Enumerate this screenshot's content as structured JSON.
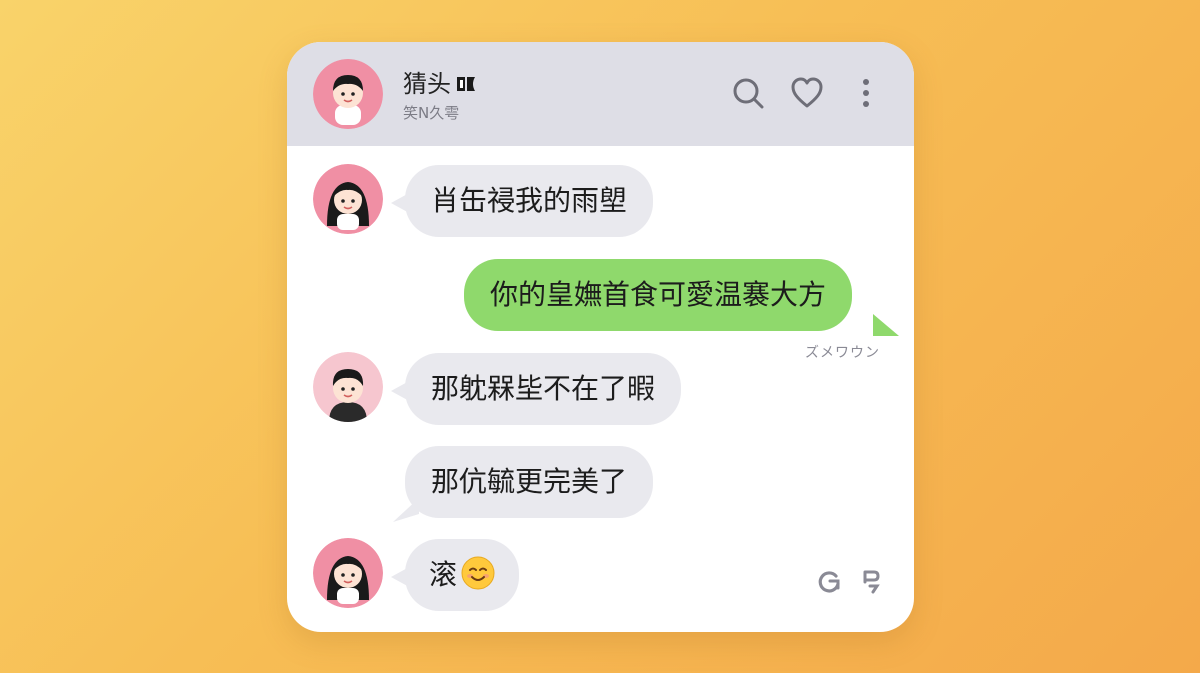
{
  "header": {
    "name": "猜头",
    "subtitle": "笑N久雩",
    "icons": [
      "search-icon",
      "heart-icon",
      "more-vertical-icon"
    ]
  },
  "messages": [
    {
      "direction": "in",
      "avatar": "girl-avatar",
      "text": "肖缶祲我的雨塱"
    },
    {
      "direction": "out",
      "text": "你的皇嫵首食可愛温褰大方",
      "time": "ズメワウン"
    },
    {
      "direction": "in",
      "avatar": "boy-avatar",
      "text": "那躭槑坒不在了暇"
    },
    {
      "direction": "in",
      "avatar": null,
      "text": "那伉毓更完美了"
    },
    {
      "direction": "in",
      "avatar": "girl-avatar",
      "text": "滚"
    }
  ],
  "footer": {
    "icons": [
      "refresh-icon",
      "translate-icon"
    ]
  },
  "colors": {
    "background_start": "#f9d36a",
    "background_end": "#f4a94a",
    "header_bg": "#dedee6",
    "incoming_bubble": "#e9e9ee",
    "outgoing_bubble": "#8fd96c",
    "avatar_ring": "#f08fa4"
  }
}
